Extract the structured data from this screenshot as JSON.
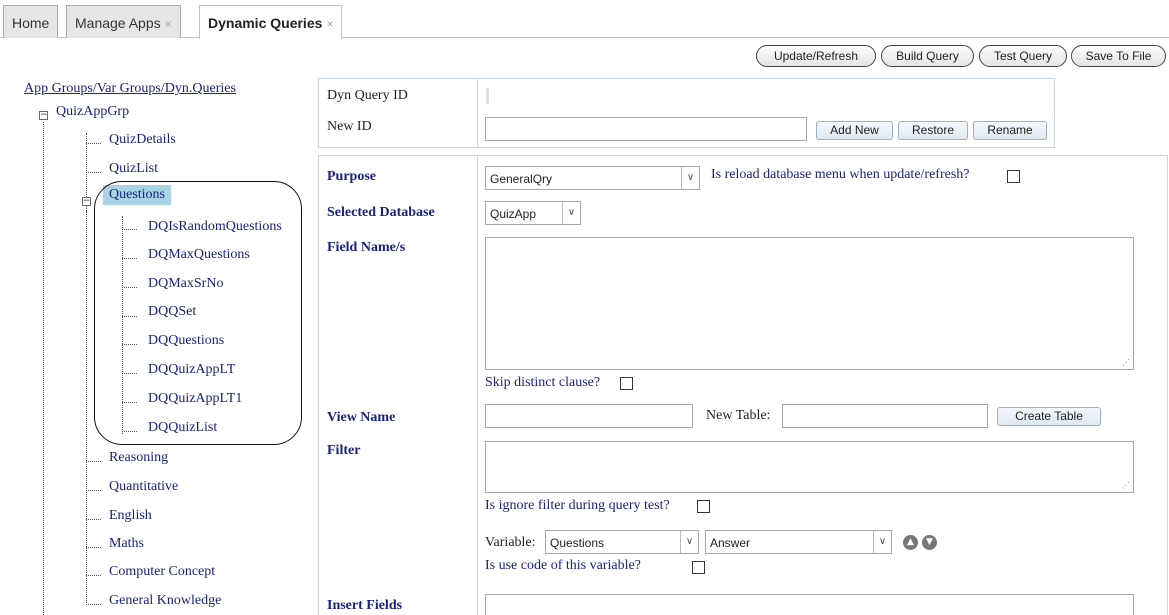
{
  "tabs": [
    {
      "label": "Home",
      "closable": false
    },
    {
      "label": "Manage Apps",
      "closable": true
    },
    {
      "label": "Dynamic Queries",
      "closable": true,
      "active": true
    }
  ],
  "toolbar": {
    "update_refresh": "Update/Refresh",
    "build_query": "Build Query",
    "test_query": "Test Query",
    "save_to_file": "Save To File"
  },
  "tree": {
    "root_label": "App Groups/Var Groups/Dyn.Queries",
    "group": "QuizAppGrp",
    "items": {
      "quiz_details": "QuizDetails",
      "quiz_list": "QuizList",
      "questions": "Questions",
      "reasoning": "Reasoning",
      "quantitative": "Quantitative",
      "english": "English",
      "maths": "Maths",
      "computer_concept": "Computer Concept",
      "general_knowledge": "General Knowledge"
    },
    "question_children": [
      "DQIsRandomQuestions",
      "DQMaxQuestions",
      "DQMaxSrNo",
      "DQQSet",
      "DQQuestions",
      "DQQuizAppLT",
      "DQQuizAppLT1",
      "DQQuizList"
    ]
  },
  "id_panel": {
    "dyn_query_id_label": "Dyn Query ID",
    "new_id_label": "New ID",
    "new_id_value": "",
    "add_new": "Add New",
    "restore": "Restore",
    "rename": "Rename"
  },
  "form": {
    "purpose_label": "Purpose",
    "purpose_value": "GeneralQry",
    "reload_menu_label": "Is reload database menu when update/refresh?",
    "selected_db_label": "Selected Database",
    "selected_db_value": "QuizApp",
    "field_names_label": "Field Name/s",
    "skip_distinct_label": "Skip distinct clause?",
    "view_name_label": "View Name",
    "new_table_label": "New Table:",
    "create_table": "Create Table",
    "filter_label": "Filter",
    "ignore_filter_label": "Is ignore filter during query test?",
    "variable_label": "Variable:",
    "variable_value": "Questions",
    "variable_field_value": "Answer",
    "use_code_label": "Is use code of this variable?",
    "insert_fields_label": "Insert Fields"
  },
  "icons": {
    "tab_close": "×",
    "collapse": "−",
    "dropdown": "∨",
    "move_up": "▲",
    "move_down": "▼",
    "resize_grip": "⋰"
  }
}
